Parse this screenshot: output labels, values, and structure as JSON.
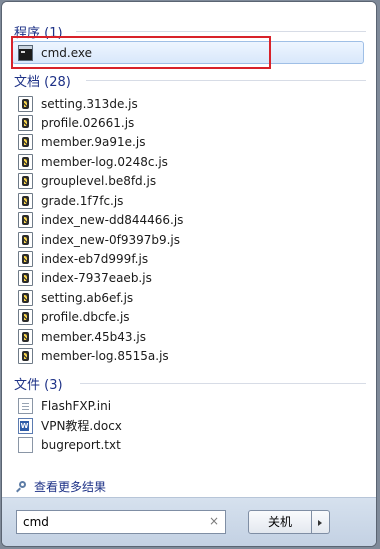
{
  "groups": {
    "programs": {
      "title": "程序 (1)",
      "items": [
        {
          "label": "cmd.exe",
          "icon": "cmd-icon"
        }
      ]
    },
    "documents": {
      "title": "文档 (28)",
      "items": [
        {
          "label": "setting.313de.js",
          "icon": "js-file-icon"
        },
        {
          "label": "profile.02661.js",
          "icon": "js-file-icon"
        },
        {
          "label": "member.9a91e.js",
          "icon": "js-file-icon"
        },
        {
          "label": "member-log.0248c.js",
          "icon": "js-file-icon"
        },
        {
          "label": "grouplevel.be8fd.js",
          "icon": "js-file-icon"
        },
        {
          "label": "grade.1f7fc.js",
          "icon": "js-file-icon"
        },
        {
          "label": "index_new-dd844466.js",
          "icon": "js-file-icon"
        },
        {
          "label": "index_new-0f9397b9.js",
          "icon": "js-file-icon"
        },
        {
          "label": "index-eb7d999f.js",
          "icon": "js-file-icon"
        },
        {
          "label": "index-7937eaeb.js",
          "icon": "js-file-icon"
        },
        {
          "label": "setting.ab6ef.js",
          "icon": "js-file-icon"
        },
        {
          "label": "profile.dbcfe.js",
          "icon": "js-file-icon"
        },
        {
          "label": "member.45b43.js",
          "icon": "js-file-icon"
        },
        {
          "label": "member-log.8515a.js",
          "icon": "js-file-icon"
        }
      ]
    },
    "files": {
      "title": "文件 (3)",
      "items": [
        {
          "label": "FlashFXP.ini",
          "icon": "ini-file-icon"
        },
        {
          "label": "VPN教程.docx",
          "icon": "word-doc-icon"
        },
        {
          "label": "bugreport.txt",
          "icon": "txt-file-icon"
        }
      ]
    }
  },
  "see_more": "查看更多结果",
  "search": {
    "value": "cmd",
    "clear": "×"
  },
  "shutdown_label": "关机",
  "colors": {
    "accent": "#1e3287",
    "highlight": "#d8222a"
  }
}
